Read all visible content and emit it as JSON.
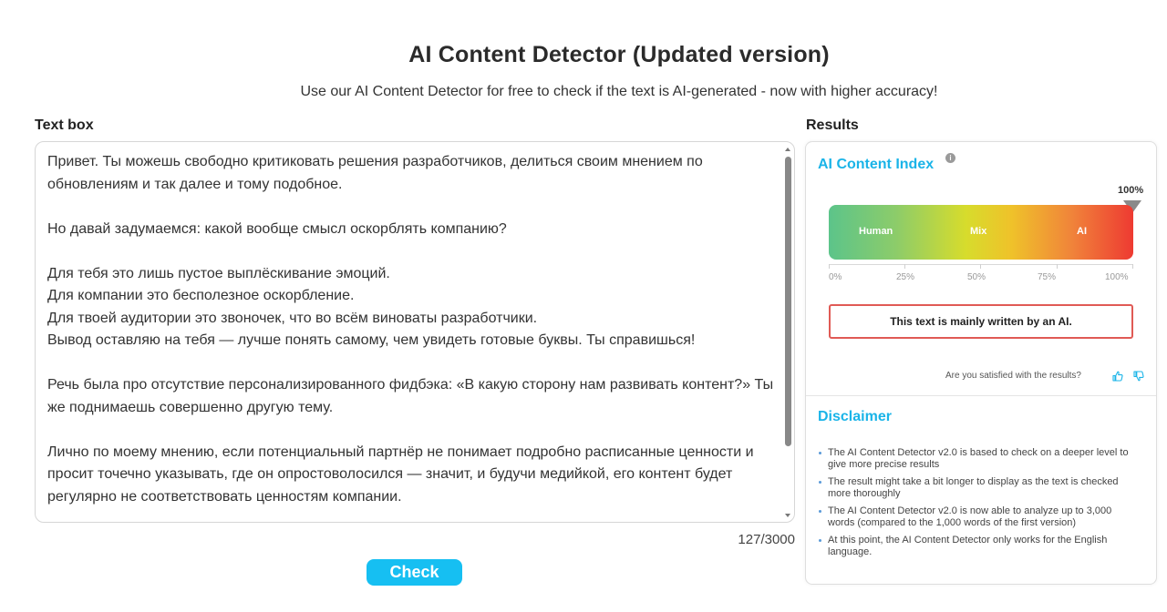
{
  "header": {
    "title": "AI Content Detector (Updated version)",
    "subtitle": "Use our AI Content Detector for free to check if the text is AI-generated - now with higher accuracy!"
  },
  "text_box": {
    "label": "Text box",
    "paragraphs": [
      "Привет. Ты можешь свободно критиковать решения разработчиков, делиться своим мнением по обновлениям и так далее и тому подобное.",
      "Но давай задумаемся: какой вообще смысл оскорблять компанию?",
      "Для тебя это лишь пустое выплёскивание эмоций.\nДля компании это бесполезное оскорбление.\nДля твоей аудитории это звоночек, что во всём виноваты разработчики.\nВывод оставляю на тебя — лучше понять самому, чем увидеть готовые буквы. Ты справишься!",
      "Речь была про отсутствие персонализированного фидбэка: «В какую сторону нам развивать контент?» Ты же поднимаешь совершенно другую тему.",
      "Лично по моему мнению, если потенциальный партнёр не понимает подробно расписанные ценности и просит точечно указывать, где он опростоволосился — значит, и будучи медийкой, его контент будет регулярно не соответствовать ценностям компании."
    ],
    "char_count": "127/3000"
  },
  "check_button": {
    "label": "Check"
  },
  "results": {
    "label": "Results",
    "index_title": "AI Content Index",
    "info_icon": "i",
    "score_label": "100%",
    "score_fraction": 1.0,
    "gauge_labels": {
      "human": "Human",
      "mix": "Mix",
      "ai": "AI"
    },
    "scale_ticks": [
      "0%",
      "25%",
      "50%",
      "75%",
      "100%"
    ],
    "verdict": "This text is mainly written by an AI.",
    "satisfied_prompt": "Are you satisfied with the results?",
    "icons": {
      "up": "thumb-up-icon",
      "down": "thumb-down-icon"
    },
    "colors": {
      "accent": "#1ab4e8",
      "button": "#16bff2",
      "verdict_border": "#e05a55"
    }
  },
  "disclaimer": {
    "title": "Disclaimer",
    "items": [
      "The AI Content Detector v2.0 is based to check on a deeper level to give more precise results",
      "The result might take a bit longer to display as the text is checked more thoroughly",
      "The AI Content Detector v2.0 is now able to analyze up to 3,000 words (compared to the 1,000 words of the first version)",
      "At this point, the AI Content Detector only works for the English language."
    ]
  }
}
